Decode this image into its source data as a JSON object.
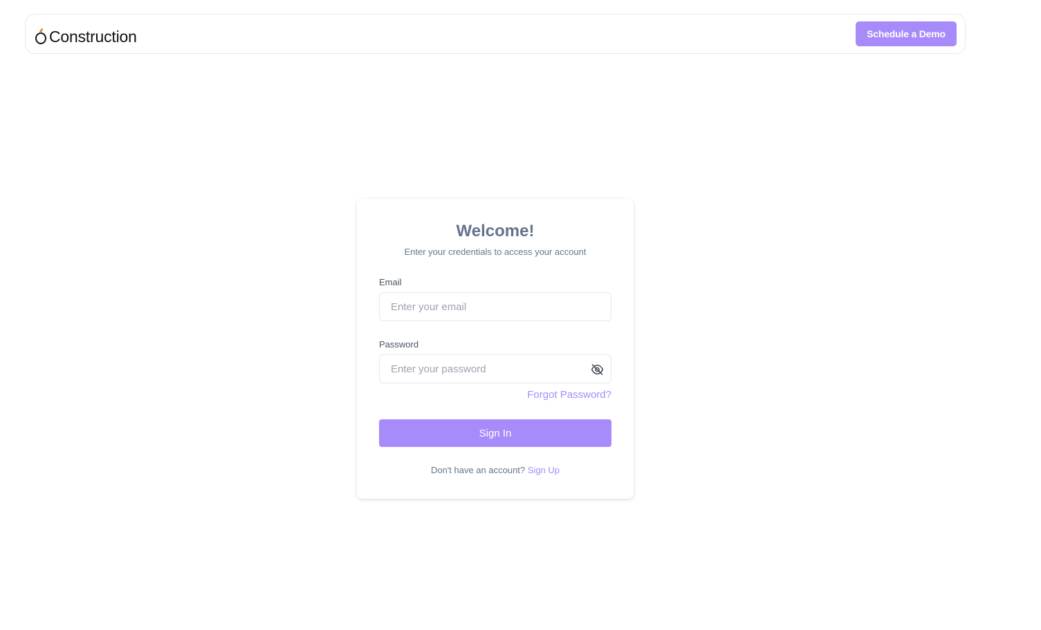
{
  "header": {
    "logo_text": "Construction",
    "demo_button_label": "Schedule a Demo"
  },
  "login": {
    "title": "Welcome!",
    "subtitle": "Enter your credentials to access your account",
    "email": {
      "label": "Email",
      "value": "",
      "placeholder": "Enter your email"
    },
    "password": {
      "label": "Password",
      "value": "",
      "placeholder": "Enter your password",
      "visibility_icon": "eye-off-icon"
    },
    "forgot_password_label": "Forgot Password?",
    "signin_button_label": "Sign In",
    "signup_prompt": "Don't have an account?",
    "signup_link_label": "Sign Up"
  },
  "colors": {
    "accent": "#a78bfa",
    "logo_accent": "#e8862a",
    "muted_text": "#64748b",
    "border": "#e5e7eb"
  }
}
